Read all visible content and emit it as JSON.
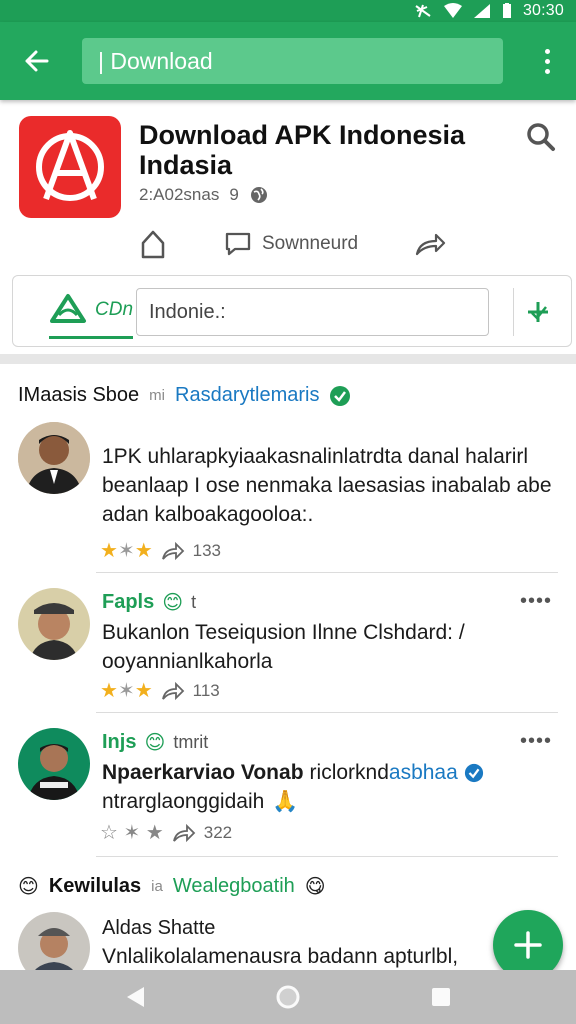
{
  "status_bar": {
    "time": "30:30"
  },
  "app_bar": {
    "search_text": "| Download"
  },
  "app": {
    "title": "Download APK Indonesia Indasia",
    "subtitle": "2:A02snas",
    "subtitle_extra": "9"
  },
  "actions": {
    "download_label": "Sownneurd"
  },
  "tabs": {
    "tab_label": "CDn",
    "input_value": "Indonie.:"
  },
  "feed": {
    "header_title": "IMaasis Sboe",
    "header_mid": "mi",
    "header_link": "Rasdarytlemaris"
  },
  "posts": [
    {
      "name": "",
      "text": "1PK uhlarapkyiaakasnalinlatrdta danal halarirl beanlaap I ose nenmaka laesasias inabalab abe adan kalboakagooloa:.",
      "count": "133"
    },
    {
      "name": "Fapls",
      "name_after": "t",
      "text": "Bukanlon Teseiqusion Ilnne Clshdard: / ooyannianlkahorla",
      "count": "113"
    },
    {
      "name": "Injs",
      "name_after": "tmrit",
      "text_bold": "Npaerkarviao Vonab",
      "text_normal": "riclorknd",
      "text_link": "asbhaa",
      "text_line2": "ntrarglaonggidaih",
      "count": "322"
    },
    {
      "name": "Kewilulas",
      "name_mid": "ia",
      "name_link": "Wealegboatih",
      "title": "Aldas Shatte",
      "text": "Vnlalikolalamenausra badann apturlbl,"
    }
  ],
  "colors": {
    "primary": "#23a85e",
    "status_bar": "#1e9e56",
    "accent_red": "#ea2b2b",
    "link_blue": "#1a79c2",
    "star": "#f2b01e"
  }
}
